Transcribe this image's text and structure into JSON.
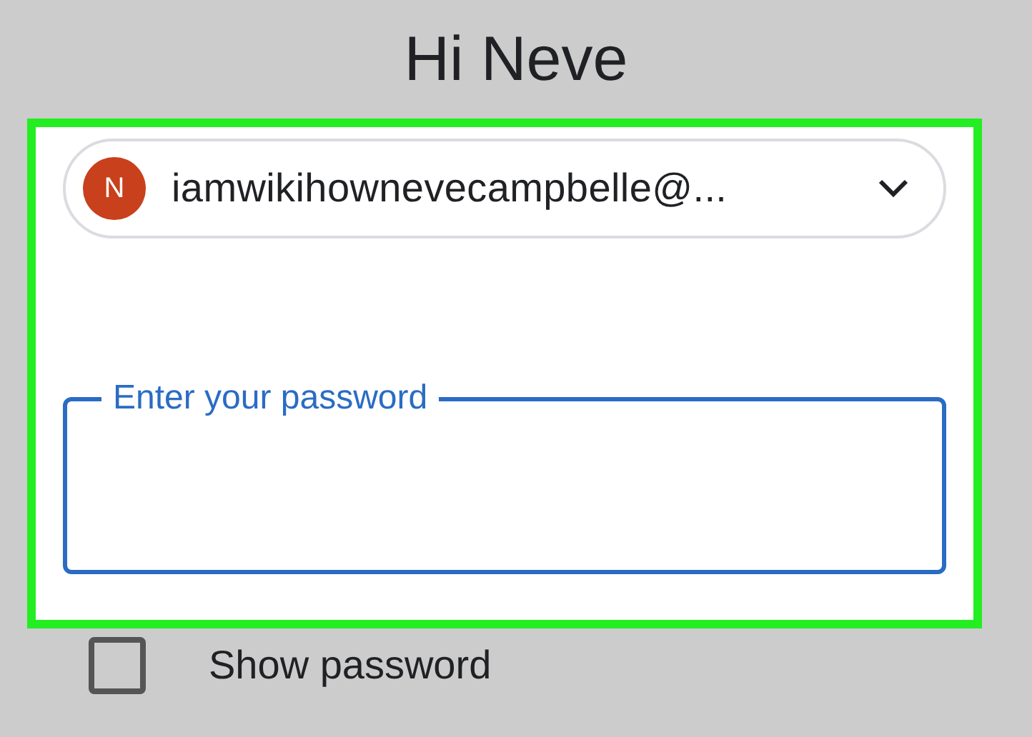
{
  "title": "Hi Neve",
  "account": {
    "initial": "N",
    "email": "iamwikihownevecampbelle@..."
  },
  "password_field": {
    "label": "Enter your password",
    "focused": true
  },
  "show_password": {
    "label": "Show password",
    "checked": false
  }
}
